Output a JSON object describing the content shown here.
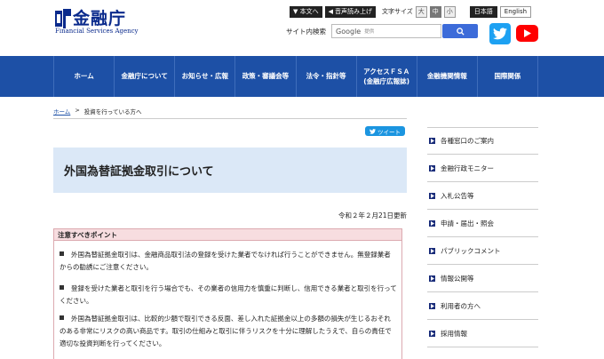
{
  "header": {
    "logo_jp": "金融庁",
    "logo_en": "Financial Services Agency",
    "skip_label": "▼ 本文へ",
    "read_aloud_label": "音声読み上げ",
    "font_size_label": "文字サイズ",
    "font_sizes": [
      "大",
      "中",
      "小"
    ],
    "lang_jp": "日本語",
    "lang_en": "English",
    "search_label": "サイト内検索",
    "search_brand": "Google",
    "search_placeholder": "提供"
  },
  "nav": {
    "items": [
      {
        "label": "ホーム"
      },
      {
        "label": "金融庁について"
      },
      {
        "label": "お知らせ・広報"
      },
      {
        "label": "政策・審議会等"
      },
      {
        "label": "法令・指針等"
      },
      {
        "label": "アクセスＦＳＡ\n(金融庁広報誌)"
      },
      {
        "label": "金融機関情報"
      },
      {
        "label": "国際関係"
      }
    ]
  },
  "breadcrumb": {
    "home": "ホーム",
    "separator": ">",
    "current": "投資を行っている方へ"
  },
  "tweet_label": "ツイート",
  "page_title": "外国為替証拠金取引について",
  "date": "令和２年２月21日更新",
  "notice": {
    "heading": "注意すべきポイント",
    "items": [
      "外国為替証拠金取引は、金融商品取引法の登録を受けた業者でなければ行うことができません。無登録業者からの勧誘にご注意ください。",
      "登録を受けた業者と取引を行う場合でも、その業者の信用力を慎重に判断し、信用できる業者と取引を行ってください。",
      "外国為替証拠金取引は、比較的少額で取引できる反面、差し入れた証拠金以上の多額の損失が生じるおそれのある非常にリスクの高い商品です。取引の仕組みと取引に伴うリスクを十分に理解したうえで、自らの責任で適切な投資判断を行ってください。"
    ]
  },
  "sidebar": {
    "items": [
      {
        "label": "各種窓口のご案内"
      },
      {
        "label": "金融行政モニター"
      },
      {
        "label": "入札公告等"
      },
      {
        "label": "申請・届出・照会"
      },
      {
        "label": "パブリックコメント"
      },
      {
        "label": "情報公開等"
      },
      {
        "label": "利用者の方へ"
      },
      {
        "label": "採用情報"
      }
    ]
  },
  "colors": {
    "nav_bg": "#1d50a6",
    "title_bg": "#dbe8f7",
    "notice_head_bg": "#f7dde0",
    "sidebar_arrow": "#1a2d7a"
  }
}
